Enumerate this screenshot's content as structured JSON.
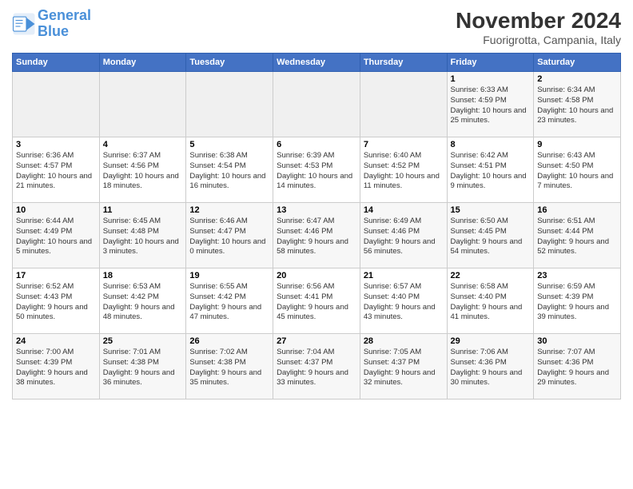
{
  "logo": {
    "line1": "General",
    "line2": "Blue"
  },
  "title": "November 2024",
  "subtitle": "Fuorigrotta, Campania, Italy",
  "weekdays": [
    "Sunday",
    "Monday",
    "Tuesday",
    "Wednesday",
    "Thursday",
    "Friday",
    "Saturday"
  ],
  "rows": [
    [
      {
        "day": "",
        "info": ""
      },
      {
        "day": "",
        "info": ""
      },
      {
        "day": "",
        "info": ""
      },
      {
        "day": "",
        "info": ""
      },
      {
        "day": "",
        "info": ""
      },
      {
        "day": "1",
        "info": "Sunrise: 6:33 AM\nSunset: 4:59 PM\nDaylight: 10 hours and 25 minutes."
      },
      {
        "day": "2",
        "info": "Sunrise: 6:34 AM\nSunset: 4:58 PM\nDaylight: 10 hours and 23 minutes."
      }
    ],
    [
      {
        "day": "3",
        "info": "Sunrise: 6:36 AM\nSunset: 4:57 PM\nDaylight: 10 hours and 21 minutes."
      },
      {
        "day": "4",
        "info": "Sunrise: 6:37 AM\nSunset: 4:56 PM\nDaylight: 10 hours and 18 minutes."
      },
      {
        "day": "5",
        "info": "Sunrise: 6:38 AM\nSunset: 4:54 PM\nDaylight: 10 hours and 16 minutes."
      },
      {
        "day": "6",
        "info": "Sunrise: 6:39 AM\nSunset: 4:53 PM\nDaylight: 10 hours and 14 minutes."
      },
      {
        "day": "7",
        "info": "Sunrise: 6:40 AM\nSunset: 4:52 PM\nDaylight: 10 hours and 11 minutes."
      },
      {
        "day": "8",
        "info": "Sunrise: 6:42 AM\nSunset: 4:51 PM\nDaylight: 10 hours and 9 minutes."
      },
      {
        "day": "9",
        "info": "Sunrise: 6:43 AM\nSunset: 4:50 PM\nDaylight: 10 hours and 7 minutes."
      }
    ],
    [
      {
        "day": "10",
        "info": "Sunrise: 6:44 AM\nSunset: 4:49 PM\nDaylight: 10 hours and 5 minutes."
      },
      {
        "day": "11",
        "info": "Sunrise: 6:45 AM\nSunset: 4:48 PM\nDaylight: 10 hours and 3 minutes."
      },
      {
        "day": "12",
        "info": "Sunrise: 6:46 AM\nSunset: 4:47 PM\nDaylight: 10 hours and 0 minutes."
      },
      {
        "day": "13",
        "info": "Sunrise: 6:47 AM\nSunset: 4:46 PM\nDaylight: 9 hours and 58 minutes."
      },
      {
        "day": "14",
        "info": "Sunrise: 6:49 AM\nSunset: 4:46 PM\nDaylight: 9 hours and 56 minutes."
      },
      {
        "day": "15",
        "info": "Sunrise: 6:50 AM\nSunset: 4:45 PM\nDaylight: 9 hours and 54 minutes."
      },
      {
        "day": "16",
        "info": "Sunrise: 6:51 AM\nSunset: 4:44 PM\nDaylight: 9 hours and 52 minutes."
      }
    ],
    [
      {
        "day": "17",
        "info": "Sunrise: 6:52 AM\nSunset: 4:43 PM\nDaylight: 9 hours and 50 minutes."
      },
      {
        "day": "18",
        "info": "Sunrise: 6:53 AM\nSunset: 4:42 PM\nDaylight: 9 hours and 48 minutes."
      },
      {
        "day": "19",
        "info": "Sunrise: 6:55 AM\nSunset: 4:42 PM\nDaylight: 9 hours and 47 minutes."
      },
      {
        "day": "20",
        "info": "Sunrise: 6:56 AM\nSunset: 4:41 PM\nDaylight: 9 hours and 45 minutes."
      },
      {
        "day": "21",
        "info": "Sunrise: 6:57 AM\nSunset: 4:40 PM\nDaylight: 9 hours and 43 minutes."
      },
      {
        "day": "22",
        "info": "Sunrise: 6:58 AM\nSunset: 4:40 PM\nDaylight: 9 hours and 41 minutes."
      },
      {
        "day": "23",
        "info": "Sunrise: 6:59 AM\nSunset: 4:39 PM\nDaylight: 9 hours and 39 minutes."
      }
    ],
    [
      {
        "day": "24",
        "info": "Sunrise: 7:00 AM\nSunset: 4:39 PM\nDaylight: 9 hours and 38 minutes."
      },
      {
        "day": "25",
        "info": "Sunrise: 7:01 AM\nSunset: 4:38 PM\nDaylight: 9 hours and 36 minutes."
      },
      {
        "day": "26",
        "info": "Sunrise: 7:02 AM\nSunset: 4:38 PM\nDaylight: 9 hours and 35 minutes."
      },
      {
        "day": "27",
        "info": "Sunrise: 7:04 AM\nSunset: 4:37 PM\nDaylight: 9 hours and 33 minutes."
      },
      {
        "day": "28",
        "info": "Sunrise: 7:05 AM\nSunset: 4:37 PM\nDaylight: 9 hours and 32 minutes."
      },
      {
        "day": "29",
        "info": "Sunrise: 7:06 AM\nSunset: 4:36 PM\nDaylight: 9 hours and 30 minutes."
      },
      {
        "day": "30",
        "info": "Sunrise: 7:07 AM\nSunset: 4:36 PM\nDaylight: 9 hours and 29 minutes."
      }
    ]
  ]
}
